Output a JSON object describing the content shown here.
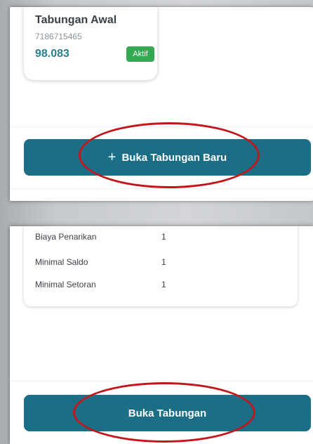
{
  "top_screen": {
    "account": {
      "title": "Tabungan Awal",
      "number": "7186715465",
      "balance": "98.083",
      "status": "Aktif"
    },
    "open_new_button": {
      "icon": "plus-icon",
      "icon_glyph": "+",
      "label": "Buka Tabungan Baru"
    }
  },
  "bottom_screen": {
    "details": [
      {
        "label": "Biaya Penarikan",
        "value": "1"
      },
      {
        "label": "Minimal Saldo",
        "value": "1"
      },
      {
        "label": "Minimal Setoran",
        "value": "1"
      }
    ],
    "open_button": {
      "label": "Buka Tabungan"
    }
  },
  "colors": {
    "primary": "#1b6e86",
    "status_active": "#34a853",
    "balance_text": "#2a7f8f",
    "highlight_ring": "#c3161c"
  }
}
